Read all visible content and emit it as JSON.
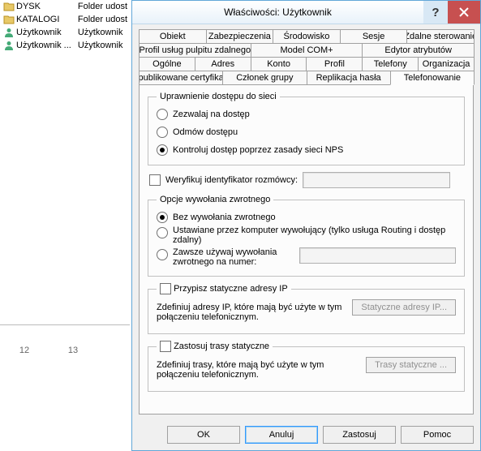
{
  "bg": {
    "rows": [
      {
        "icon": "folder",
        "name": "DYSK",
        "type": "Folder udost"
      },
      {
        "icon": "folder",
        "name": "KATALOGI",
        "type": "Folder udost"
      },
      {
        "icon": "user",
        "name": "Użytkownik",
        "type": "Użytkownik"
      },
      {
        "icon": "user",
        "name": "Użytkownik ...",
        "type": "Użytkownik"
      }
    ],
    "ruler": {
      "a": "12",
      "b": "13"
    }
  },
  "dialog": {
    "title": "Właściwości: Użytkownik",
    "tabs": {
      "r1": [
        "Obiekt",
        "Zabezpieczenia",
        "Środowisko",
        "Sesje",
        "Zdalne sterowanie"
      ],
      "r2": [
        "Profil usług pulpitu zdalnego",
        "Model COM+",
        "Edytor atrybutów"
      ],
      "r3": [
        "Ogólne",
        "Adres",
        "Konto",
        "Profil",
        "Telefony",
        "Organizacja"
      ],
      "r4": [
        "Opublikowane certyfikaty",
        "Członek grupy",
        "Replikacja hasła",
        "Telefonowanie"
      ]
    },
    "active_tab": "Telefonowanie",
    "panel": {
      "group1": {
        "legend": "Uprawnienie dostępu do sieci",
        "opt1": "Zezwalaj na dostęp",
        "opt2": "Odmów dostępu",
        "opt3": "Kontroluj dostęp poprzez zasady sieci NPS"
      },
      "verify_label": "Weryfikuj identyfikator rozmówcy:",
      "group2": {
        "legend": "Opcje wywołania zwrotnego",
        "opt1": "Bez wywołania zwrotnego",
        "opt2": "Ustawiane przez komputer wywołujący (tylko usługa Routing i dostęp zdalny)",
        "opt3": "Zawsze używaj wywołania zwrotnego na numer:"
      },
      "group3": {
        "legend": "Przypisz statyczne adresy IP",
        "desc": "Zdefiniuj adresy IP, które mają być użyte w tym połączeniu telefonicznym.",
        "btn": "Statyczne adresy IP..."
      },
      "group4": {
        "legend": "Zastosuj trasy statyczne",
        "desc": "Zdefiniuj trasy, które mają być użyte w tym połączeniu telefonicznym.",
        "btn": "Trasy statyczne ..."
      }
    },
    "footer": {
      "ok": "OK",
      "cancel": "Anuluj",
      "apply": "Zastosuj",
      "help": "Pomoc"
    }
  }
}
